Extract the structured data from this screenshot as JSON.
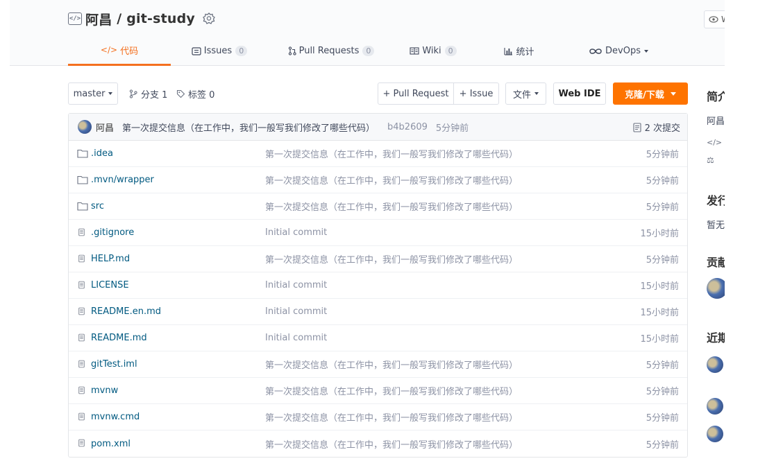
{
  "repo": {
    "owner": "阿昌",
    "separator": " / ",
    "name": "git-study",
    "watch_label": "W"
  },
  "tabs": [
    {
      "label": "代码",
      "icon": "code-icon",
      "count": null,
      "active": true
    },
    {
      "label": "Issues",
      "icon": "issues-icon",
      "count": "0",
      "active": false
    },
    {
      "label": "Pull Requests",
      "icon": "pull-request-icon",
      "count": "0",
      "active": false
    },
    {
      "label": "Wiki",
      "icon": "wiki-icon",
      "count": "0",
      "active": false
    },
    {
      "label": "统计",
      "icon": "stats-icon",
      "count": null,
      "active": false
    },
    {
      "label": "DevOps",
      "icon": "devops-icon",
      "count": null,
      "active": false
    }
  ],
  "toolbar": {
    "branch": "master",
    "branches_label": "分支 1",
    "tags_label": "标签 0",
    "pull_request_label": "+ Pull Request",
    "issue_label": "+ Issue",
    "file_label": "文件",
    "webide_label": "Web IDE",
    "clone_label": "克隆/下载"
  },
  "commit": {
    "author": "阿昌",
    "message": "第一次提交信息（在工作中，我们一般写我们修改了哪些代码）",
    "sha": "b4b2609",
    "time": "5分钟前",
    "count_label": "2 次提交"
  },
  "files": [
    {
      "type": "folder",
      "name": ".idea",
      "message": "第一次提交信息（在工作中，我们一般写我们修改了哪些代码）",
      "time": "5分钟前"
    },
    {
      "type": "folder",
      "name": ".mvn/wrapper",
      "message": "第一次提交信息（在工作中，我们一般写我们修改了哪些代码）",
      "time": "5分钟前"
    },
    {
      "type": "folder",
      "name": "src",
      "message": "第一次提交信息（在工作中，我们一般写我们修改了哪些代码）",
      "time": "5分钟前"
    },
    {
      "type": "file",
      "name": ".gitignore",
      "message": "Initial commit",
      "time": "15小时前"
    },
    {
      "type": "file",
      "name": "HELP.md",
      "message": "第一次提交信息（在工作中，我们一般写我们修改了哪些代码）",
      "time": "5分钟前"
    },
    {
      "type": "file",
      "name": "LICENSE",
      "message": "Initial commit",
      "time": "15小时前"
    },
    {
      "type": "file",
      "name": "README.en.md",
      "message": "Initial commit",
      "time": "15小时前"
    },
    {
      "type": "file",
      "name": "README.md",
      "message": "Initial commit",
      "time": "15小时前"
    },
    {
      "type": "file",
      "name": "gitTest.iml",
      "message": "第一次提交信息（在工作中，我们一般写我们修改了哪些代码）",
      "time": "5分钟前"
    },
    {
      "type": "file",
      "name": "mvnw",
      "message": "第一次提交信息（在工作中，我们一般写我们修改了哪些代码）",
      "time": "5分钟前"
    },
    {
      "type": "file",
      "name": "mvnw.cmd",
      "message": "第一次提交信息（在工作中，我们一般写我们修改了哪些代码）",
      "time": "5分钟前"
    },
    {
      "type": "file",
      "name": "pom.xml",
      "message": "第一次提交信息（在工作中，我们一般写我们修改了哪些代码）",
      "time": "5分钟前"
    }
  ],
  "sidebar": {
    "intro_title": "简介",
    "intro_text": "阿昌",
    "release_title": "发行",
    "release_text": "暂无",
    "contrib_title": "贡献",
    "recent_title": "近期"
  },
  "colors": {
    "accent": "#f4701f",
    "link": "#005980",
    "muted": "#8c92a4"
  }
}
